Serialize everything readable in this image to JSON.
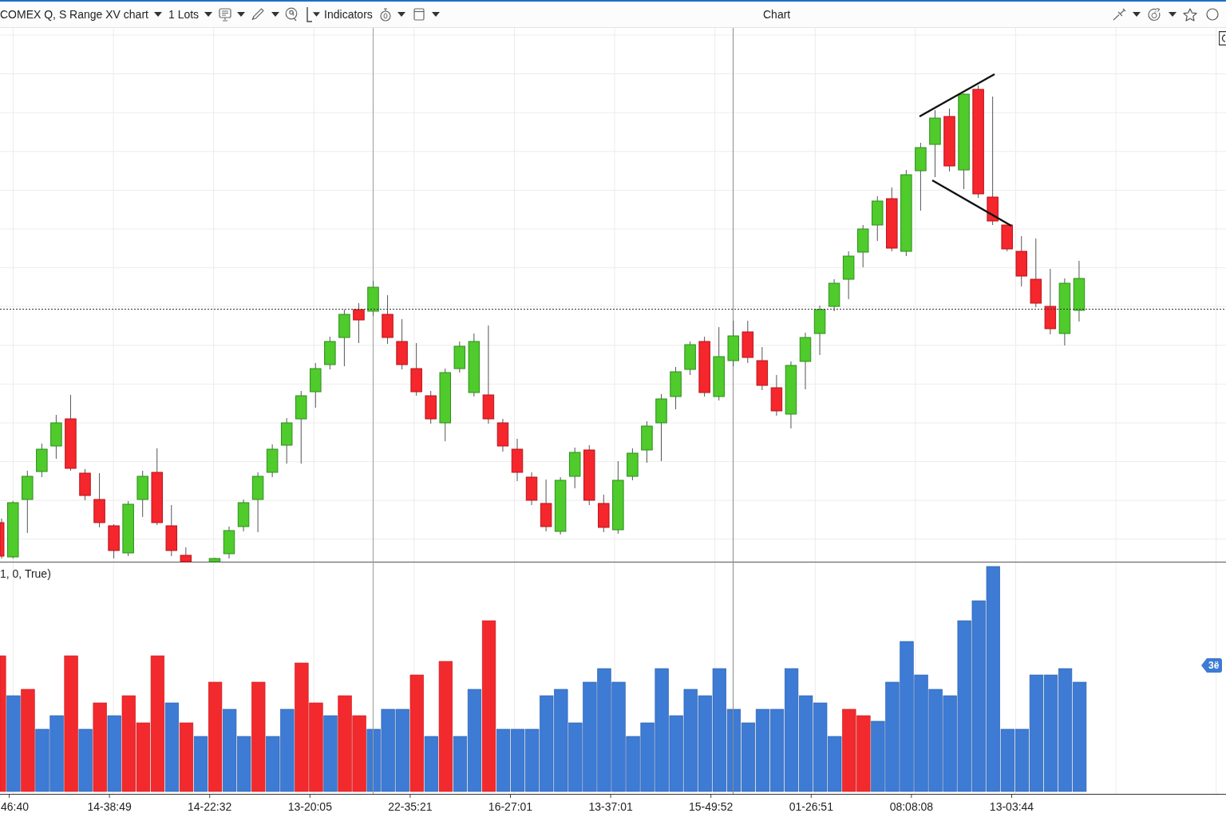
{
  "toolbar": {
    "symbol": "COMEX Q, S Range XV chart",
    "lots": "1 Lots",
    "indicators": "Indicators",
    "title": "Chart"
  },
  "volume_pane": {
    "study_label": "1, 0, True)",
    "price_badge": "3ë"
  },
  "time_axis": {
    "labels": [
      "46:40",
      "14-38:49",
      "14-22:32",
      "13-20:05",
      "22-35:21",
      "16-27:01",
      "13-37:01",
      "15-49:52",
      "01-26:51",
      "08:08:08",
      "13-03:44"
    ]
  }
}
